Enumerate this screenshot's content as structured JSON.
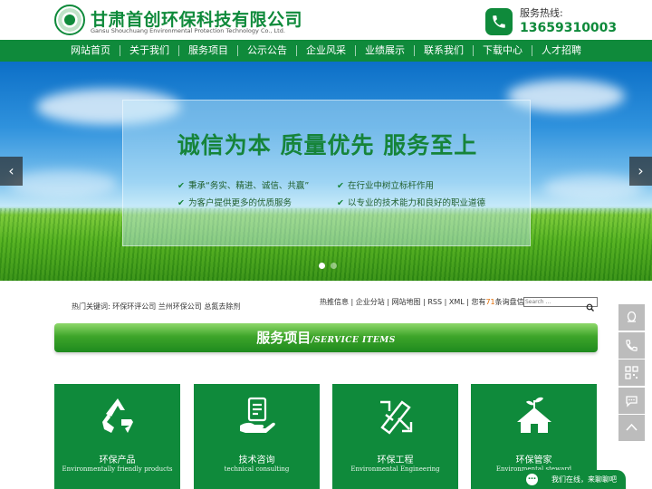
{
  "header": {
    "company_cn": "甘肃首创环保科技有限公司",
    "company_en": "Gansu Shouchuang Environmental Protection Technology Co., Ltd.",
    "hotline_label": "服务热线:",
    "hotline_number": "13659310003"
  },
  "nav": {
    "items": [
      {
        "label": "网站首页"
      },
      {
        "label": "关于我们"
      },
      {
        "label": "服务项目"
      },
      {
        "label": "公示公告"
      },
      {
        "label": "企业风采"
      },
      {
        "label": "业绩展示"
      },
      {
        "label": "联系我们"
      },
      {
        "label": "下载中心"
      },
      {
        "label": "人才招聘"
      }
    ]
  },
  "banner": {
    "slogan": "诚信为本  质量优先  服务至上",
    "bullets": [
      "秉承“务实、精进、诚信、共赢”",
      "在行业中树立标杆作用",
      "为客户提供更多的优质服务",
      "以专业的技术能力和良好的职业道德"
    ],
    "prev_arrow": "‹",
    "next_arrow": "›",
    "slide_count": 2,
    "active_slide": 1
  },
  "infobar": {
    "hot_keywords_label": "热门关键词:",
    "hot_keywords": "环保环评公司 兰州环保公司 总氮去除剂",
    "links": [
      "热推信息",
      "企业分站",
      "网站地图",
      "RSS",
      "XML"
    ],
    "pre_count": "您有",
    "count": "71",
    "post_count": "条询盘信息!",
    "search_placeholder": "Search ..."
  },
  "section": {
    "title_cn": "服务项目",
    "title_en": "/SERVICE ITEMS"
  },
  "services": [
    {
      "cn": "环保产品",
      "en": "Environmentally friendly products",
      "icon": "recycle-icon"
    },
    {
      "cn": "技术咨询",
      "en": "technical consulting",
      "icon": "consulting-icon"
    },
    {
      "cn": "环保工程",
      "en": "Environmental Engineering",
      "icon": "engineering-icon"
    },
    {
      "cn": "环保管家",
      "en": "Environmental steward",
      "icon": "house-plant-icon"
    }
  ],
  "chat": {
    "text": "我们在线，来聊聊吧"
  },
  "colors": {
    "brand_green": "#0f8a3b",
    "accent_orange": "#e06a00",
    "side_gray": "#bcbcbc"
  }
}
